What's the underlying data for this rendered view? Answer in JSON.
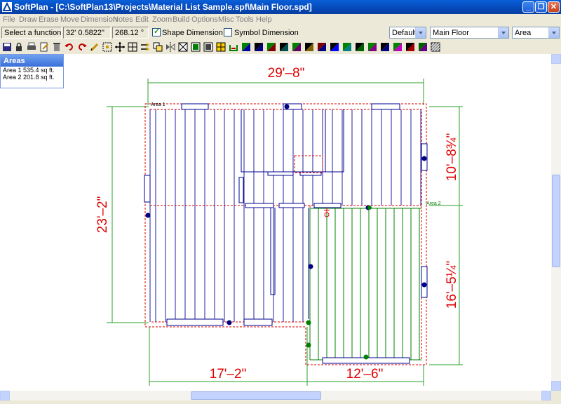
{
  "window": {
    "title": "SoftPlan - [C:\\SoftPlan13\\Projects\\Material List Sample.spf\\Main Floor.spd]",
    "minimize_icon": "minimize-icon",
    "restore_icon": "restore-icon",
    "close_icon": "close-icon"
  },
  "menu": [
    "File",
    "Draw",
    "Erase",
    "Move",
    "Dimension",
    "Notes",
    "Edit",
    "Zoom",
    "Build",
    "Options",
    "Misc",
    "Tools",
    "Help"
  ],
  "status": {
    "prompt": "Select a function",
    "coord_x": "32' 0.5822\"",
    "angle": "268.12 °",
    "shape_dimension_label": "Shape Dimension",
    "shape_dimension_checked": true,
    "symbol_dimension_label": "Symbol Dimension",
    "symbol_dimension_checked": false,
    "style_select": "Default",
    "floor_select": "Main Floor",
    "mode_select": "Area"
  },
  "toolbar_icons": [
    "save-icon",
    "lock-icon",
    "print-icon",
    "edit-icon",
    "trash-icon",
    "undo-icon",
    "redo-icon",
    "pencil-icon",
    "select-icon",
    "move-icon",
    "grid-icon",
    "arrows-icon",
    "copy-icon",
    "mirror-icon",
    "frame-icon",
    "layer-icon",
    "layer2-icon",
    "layer3-icon",
    "layer4-icon",
    "color-icon",
    "color-icon",
    "color-icon",
    "color-icon",
    "color-icon",
    "color-icon",
    "color-icon",
    "color-icon",
    "color-icon",
    "color-icon",
    "color-icon",
    "color-icon",
    "color-icon",
    "color-icon",
    "hatch-icon"
  ],
  "areas_panel": {
    "title": "Areas",
    "rows": [
      "Area 1 535.4 sq ft.",
      "Area 2 201.8 sq ft."
    ]
  },
  "drawing": {
    "dim_top": "29'–8\"",
    "dim_left": "23'–2\"",
    "dim_right_upper": "10'–8¾\"",
    "dim_right_lower": "16'–5¼\"",
    "dim_bottom_left": "17'–2\"",
    "dim_bottom_right": "12'–6\"",
    "label_area1": "Area 1",
    "label_area2": "Area 2",
    "colors": {
      "wall": "#000090",
      "dim": "#e00000",
      "area1": "#2020a0",
      "area2": "#008000",
      "dashed": "#e00000"
    }
  }
}
